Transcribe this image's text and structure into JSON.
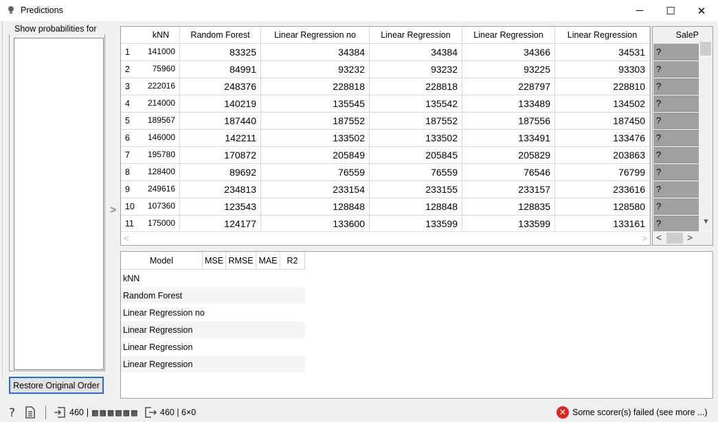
{
  "window": {
    "title": "Predictions",
    "minimize": "─",
    "maximize": "☐",
    "close": "✕"
  },
  "left_panel": {
    "prob_label": "Show probabilities for",
    "restore_button": "Restore Original Order"
  },
  "predictions": {
    "columns": [
      "kNN",
      "Random Forest",
      "Linear Regression no",
      "Linear Regression",
      "Linear Regression",
      "Linear Regression"
    ],
    "target_column": "SaleP",
    "rows": [
      {
        "idx": "1",
        "knn": "141000",
        "rf": "83325",
        "lr_no": "34384",
        "lr1": "34384",
        "lr2": "34366",
        "lr3": "34531",
        "target": "?"
      },
      {
        "idx": "2",
        "knn": "75960",
        "rf": "84991",
        "lr_no": "93232",
        "lr1": "93232",
        "lr2": "93225",
        "lr3": "93303",
        "target": "?"
      },
      {
        "idx": "3",
        "knn": "222016",
        "rf": "248376",
        "lr_no": "228818",
        "lr1": "228818",
        "lr2": "228797",
        "lr3": "228810",
        "target": "?"
      },
      {
        "idx": "4",
        "knn": "214000",
        "rf": "140219",
        "lr_no": "135545",
        "lr1": "135542",
        "lr2": "133489",
        "lr3": "134502",
        "target": "?"
      },
      {
        "idx": "5",
        "knn": "189567",
        "rf": "187440",
        "lr_no": "187552",
        "lr1": "187552",
        "lr2": "187556",
        "lr3": "187450",
        "target": "?"
      },
      {
        "idx": "6",
        "knn": "146000",
        "rf": "142211",
        "lr_no": "133502",
        "lr1": "133502",
        "lr2": "133491",
        "lr3": "133476",
        "target": "?"
      },
      {
        "idx": "7",
        "knn": "195780",
        "rf": "170872",
        "lr_no": "205849",
        "lr1": "205845",
        "lr2": "205829",
        "lr3": "203863",
        "target": "?"
      },
      {
        "idx": "8",
        "knn": "128400",
        "rf": "89692",
        "lr_no": "76559",
        "lr1": "76559",
        "lr2": "76546",
        "lr3": "76799",
        "target": "?"
      },
      {
        "idx": "9",
        "knn": "249616",
        "rf": "234813",
        "lr_no": "233154",
        "lr1": "233155",
        "lr2": "233157",
        "lr3": "233616",
        "target": "?"
      },
      {
        "idx": "10",
        "knn": "107360",
        "rf": "123543",
        "lr_no": "128848",
        "lr1": "128848",
        "lr2": "128835",
        "lr3": "128580",
        "target": "?"
      },
      {
        "idx": "11",
        "knn": "175000",
        "rf": "124177",
        "lr_no": "133600",
        "lr1": "133599",
        "lr2": "133599",
        "lr3": "133161",
        "target": "?"
      }
    ]
  },
  "scores": {
    "columns": [
      "Model",
      "MSE",
      "RMSE",
      "MAE",
      "R2"
    ],
    "models": [
      "kNN",
      "Random Forest",
      "Linear Regression no",
      "Linear Regression",
      "Linear Regression",
      "Linear Regression"
    ]
  },
  "status": {
    "input_count": "460",
    "input_garbled": "▩▩▩▩▩▩",
    "output_info": "460 | 6×0",
    "error_text": "Some scorer(s) failed (see more ...)"
  },
  "colors": {
    "accent": "#1e6fd0",
    "error": "#e0241b",
    "target_cell": "#a0a0a0"
  }
}
